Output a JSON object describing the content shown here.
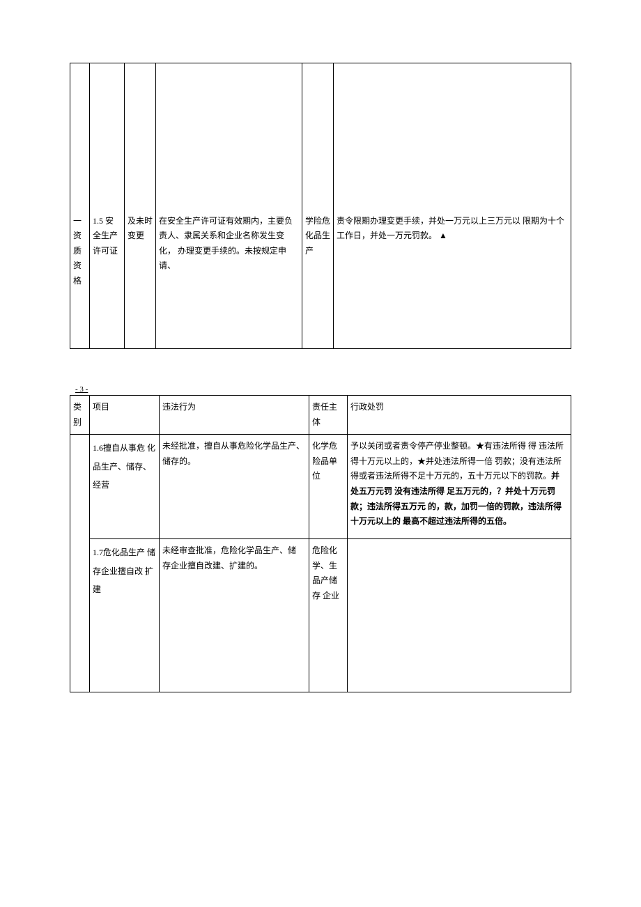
{
  "table1": {
    "row": {
      "category": "一 资 质 资 格",
      "project": "1.5 安全生产许可证",
      "sub": "及未时变更",
      "behavior": "在安全生产许可证有效期内，主要负 责人、隶属关系和企业名称发生变化， 办理变更手续的。未按规定申请、",
      "subject": "学险危 化品生 产",
      "penalty": "责令限期办理变更手续，并处一万元以上三万元以 限期为十个工作日，并处一万元罚款。  ▲"
    }
  },
  "pageNum": "- 3 -",
  "table2": {
    "headers": {
      "category": "类 别",
      "project": "项目",
      "behavior": "违法行为",
      "subject": "责任主 体",
      "penalty": "行政处罚"
    },
    "rows": [
      {
        "project": "1.6擅自从事危 化品生产、储存、经营",
        "behavior": "未经批准，擅自从事危险化学品生产、储存的。",
        "subject": "化学危  险品单  位",
        "penalty_pre": "予以关闭或者责令停产停业整顿。★有违法所得 得 违法所得十万元以上的，★并处违法所得一倍 罚款；没有违法所得或者违法所得不足十万元的，五十万元以下的罚款。",
        "penalty_bold": "并处五万元罚 没有违法所得  足五万元的，？并处十万元罚款；违法所得五万元  的，款，加罚一倍的罚款，违法所得十万元以上的   最高不超过违法所得的五倍。"
      },
      {
        "project": "1.7危化品生产 储存企业擅自改 扩建",
        "behavior": "未经审查批准，危险化学品生产、储  存企业擅自改建、扩建的。",
        "subject": "危险化 学、生品产储存  企业",
        "penalty": ""
      }
    ]
  }
}
